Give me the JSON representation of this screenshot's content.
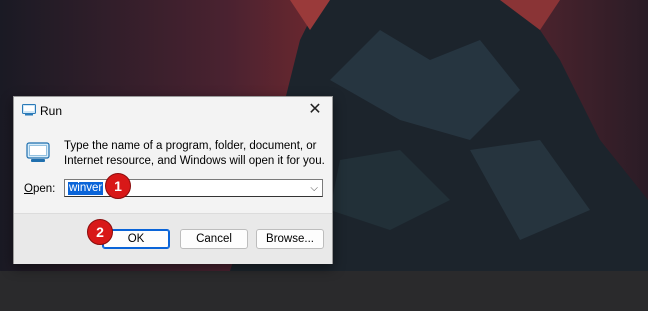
{
  "dialog": {
    "title": "Run",
    "close_glyph": "✕",
    "description": "Type the name of a program, folder, document, or Internet resource, and Windows will open it for you.",
    "open_label_prefix": "O",
    "open_label_rest": "pen:",
    "command_value": "winver",
    "dropdown_glyph": "⌵",
    "ok_label": "OK",
    "cancel_label": "Cancel",
    "browse_label": "Browse..."
  },
  "callouts": {
    "step1": "1",
    "step2": "2"
  },
  "icons": {
    "title": "run-icon",
    "description": "run-app-icon",
    "close": "close-icon",
    "dropdown": "chevron-down-icon"
  },
  "colors": {
    "selection": "#0a64d8",
    "callout": "#d81818",
    "dialog_bg": "#f3f3f3",
    "footer_bg": "#e9e9e9"
  }
}
